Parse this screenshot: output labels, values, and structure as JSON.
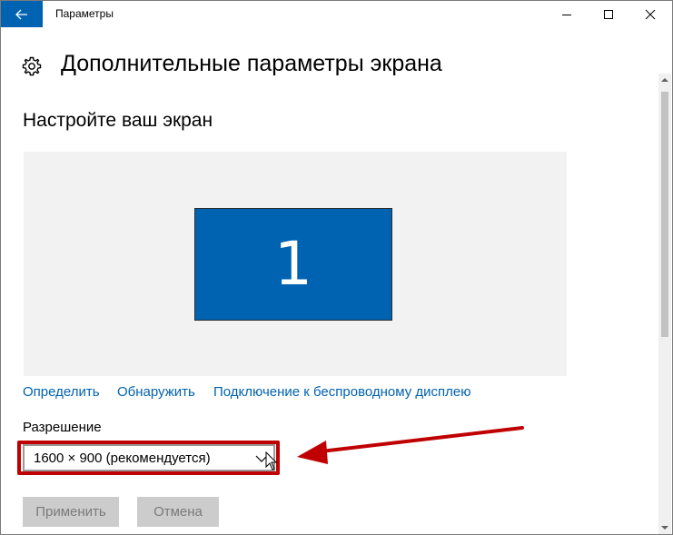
{
  "window": {
    "title": "Параметры"
  },
  "header": {
    "title": "Дополнительные параметры экрана",
    "icon": "gear-icon"
  },
  "main": {
    "section_title": "Настройте ваш экран",
    "display": {
      "monitor_number": "1",
      "monitor_color": "#0063b1"
    },
    "links": {
      "identify": "Определить",
      "detect": "Обнаружить",
      "wireless": "Подключение к беспроводному дисплею"
    },
    "resolution": {
      "label": "Разрешение",
      "selected": "1600 × 900 (рекомендуется)"
    },
    "buttons": {
      "apply": "Применить",
      "cancel": "Отмена"
    }
  },
  "colors": {
    "accent": "#0063b1",
    "annotation": "#c00000"
  }
}
